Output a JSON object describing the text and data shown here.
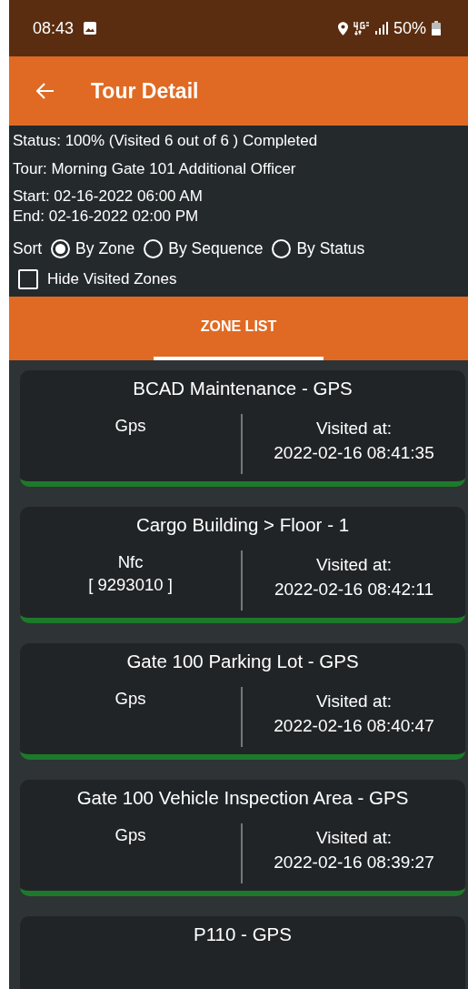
{
  "status_bar": {
    "time": "08:43",
    "battery": "50%"
  },
  "app_bar": {
    "title": "Tour Detail"
  },
  "info": {
    "status": "Status: 100% (Visited 6 out of 6 ) Completed",
    "tour": "Tour: Morning Gate 101 Additional Officer",
    "start": "Start: 02-16-2022 06:00 AM",
    "end": "End: 02-16-2022 02:00 PM"
  },
  "sort": {
    "label": "Sort",
    "options": [
      {
        "label": "By Zone",
        "selected": true
      },
      {
        "label": "By Sequence",
        "selected": false
      },
      {
        "label": "By Status",
        "selected": false
      }
    ]
  },
  "hide_visited": {
    "label": "Hide Visited Zones",
    "checked": false
  },
  "tabs": [
    {
      "label": "ZONE LIST",
      "selected": true
    }
  ],
  "zones": [
    {
      "name": "BCAD Maintenance - GPS",
      "method": "Gps",
      "visited_label": "Visited at:",
      "visited_time": "2022-02-16 08:41:35",
      "visited": true
    },
    {
      "name": "Cargo Building > Floor - 1",
      "method": "Nfc",
      "tag": "[ 9293010 ]",
      "visited_label": "Visited at:",
      "visited_time": "2022-02-16 08:42:11",
      "visited": true
    },
    {
      "name": "Gate 100 Parking Lot - GPS",
      "method": "Gps",
      "visited_label": "Visited at:",
      "visited_time": "2022-02-16 08:40:47",
      "visited": true
    },
    {
      "name": "Gate 100 Vehicle Inspection Area - GPS",
      "method": "Gps",
      "visited_label": "Visited at:",
      "visited_time": "2022-02-16 08:39:27",
      "visited": true
    },
    {
      "name": "P110 - GPS"
    }
  ]
}
